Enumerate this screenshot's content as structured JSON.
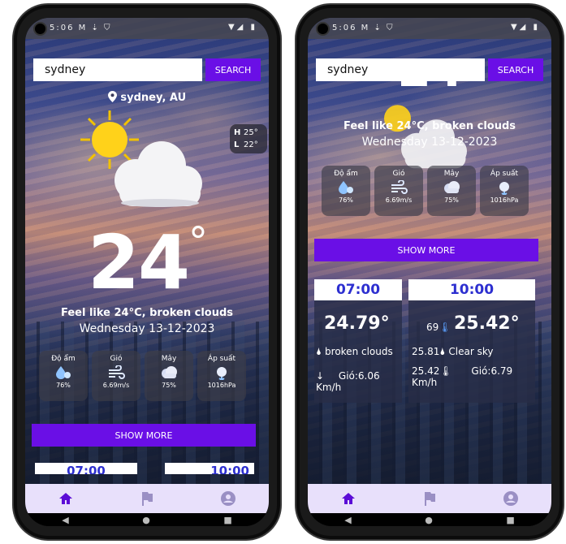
{
  "status_bar": {
    "left": "5:06 M ⇣ ⛉",
    "right": "▼◢ ▮"
  },
  "search": {
    "value": "sydney",
    "button_label": "SEARCH"
  },
  "location": {
    "label": "sydney, AU"
  },
  "highlow": {
    "h_label": "H",
    "h_value": "25°",
    "l_label": "L",
    "l_value": "22°"
  },
  "current": {
    "temp": "24",
    "unit": "°",
    "feel": "Feel like 24°C, broken clouds",
    "date": "Wednesday 13-12-2023",
    "partial_temp": "24"
  },
  "stats": [
    {
      "label": "Độ ẩm",
      "value": "76%",
      "icon": "humidity-icon"
    },
    {
      "label": "Gió",
      "value": "6.69m/s",
      "icon": "wind-icon"
    },
    {
      "label": "Mây",
      "value": "75%",
      "icon": "cloud-icon"
    },
    {
      "label": "Áp suất",
      "value": "1016hPa",
      "icon": "pressure-icon"
    }
  ],
  "show_more": "SHOW MORE",
  "forecast": [
    {
      "time": "07:00",
      "temp": "24.79°",
      "desc": "broken clouds",
      "wind": "Gió:6.06 Km/h",
      "partial_time": "07:00"
    },
    {
      "time": "10:00",
      "temp": "25.42°",
      "humidity": "69",
      "feel": "25.81",
      "desc": "Clear sky",
      "min": "25.42",
      "wind": "Gió:6.79 Km/h",
      "partial_time": "10:00"
    }
  ],
  "nav": [
    "home-icon",
    "flag-icon",
    "account-icon"
  ],
  "sysnav": [
    "◀",
    "●",
    "■"
  ],
  "colors": {
    "accent": "#6a0fe6",
    "nav_active": "#5b0cd6",
    "nav_inactive": "#9a8fc4",
    "forecast_head_text": "#2d2fd0"
  }
}
